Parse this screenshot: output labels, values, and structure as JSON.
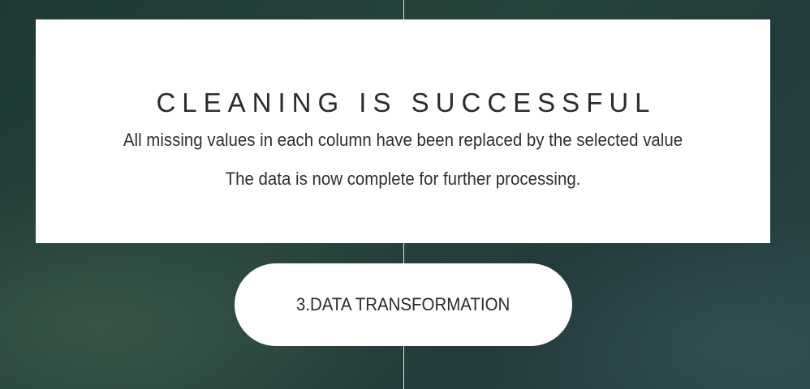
{
  "card": {
    "title": "CLEANING IS SUCCESSFUL",
    "line1": "All missing values in each column have been replaced by the selected value",
    "line2": "The data is now complete for further processing."
  },
  "button": {
    "label": "3.DATA TRANSFORMATION"
  },
  "colors": {
    "background": "#26433c",
    "card": "#ffffff",
    "text": "#2b2b2b"
  }
}
